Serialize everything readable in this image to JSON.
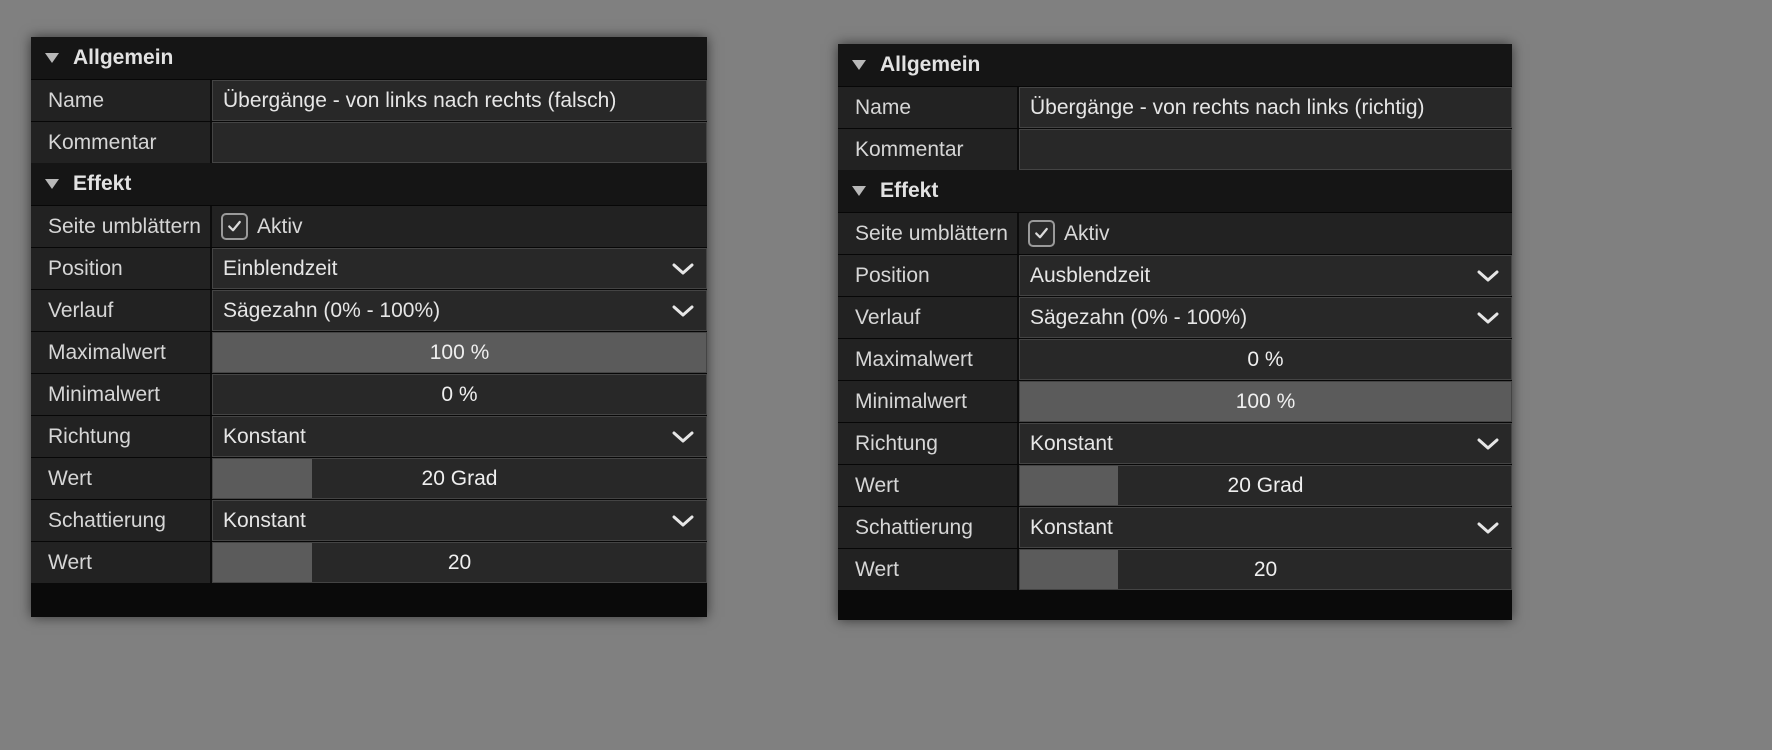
{
  "sections": {
    "general": "Allgemein",
    "effect": "Effekt"
  },
  "labels": {
    "name": "Name",
    "comment": "Kommentar",
    "pageturn": "Seite umblättern",
    "active": "Aktiv",
    "position": "Position",
    "gradient": "Verlauf",
    "max": "Maximalwert",
    "min": "Minimalwert",
    "direction": "Richtung",
    "value": "Wert",
    "shading": "Schattierung"
  },
  "left": {
    "name": "Übergänge - von links nach rechts (falsch)",
    "comment": "",
    "active": true,
    "position": "Einblendzeit",
    "gradient": "Sägezahn (0% - 100%)",
    "max": {
      "text": "100 %",
      "fill": 100
    },
    "min": {
      "text": "0 %",
      "fill": 0
    },
    "direction": "Konstant",
    "dirValue": {
      "text": "20 Grad",
      "fill": 20
    },
    "shading": "Konstant",
    "shadeValue": {
      "text": "20",
      "fill": 20
    }
  },
  "right": {
    "name": "Übergänge - von rechts nach links (richtig)",
    "comment": "",
    "active": true,
    "position": "Ausblendzeit",
    "gradient": "Sägezahn (0% - 100%)",
    "max": {
      "text": "0 %",
      "fill": 0
    },
    "min": {
      "text": "100 %",
      "fill": 100
    },
    "direction": "Konstant",
    "dirValue": {
      "text": "20 Grad",
      "fill": 20
    },
    "shading": "Konstant",
    "shadeValue": {
      "text": "20",
      "fill": 20
    }
  }
}
